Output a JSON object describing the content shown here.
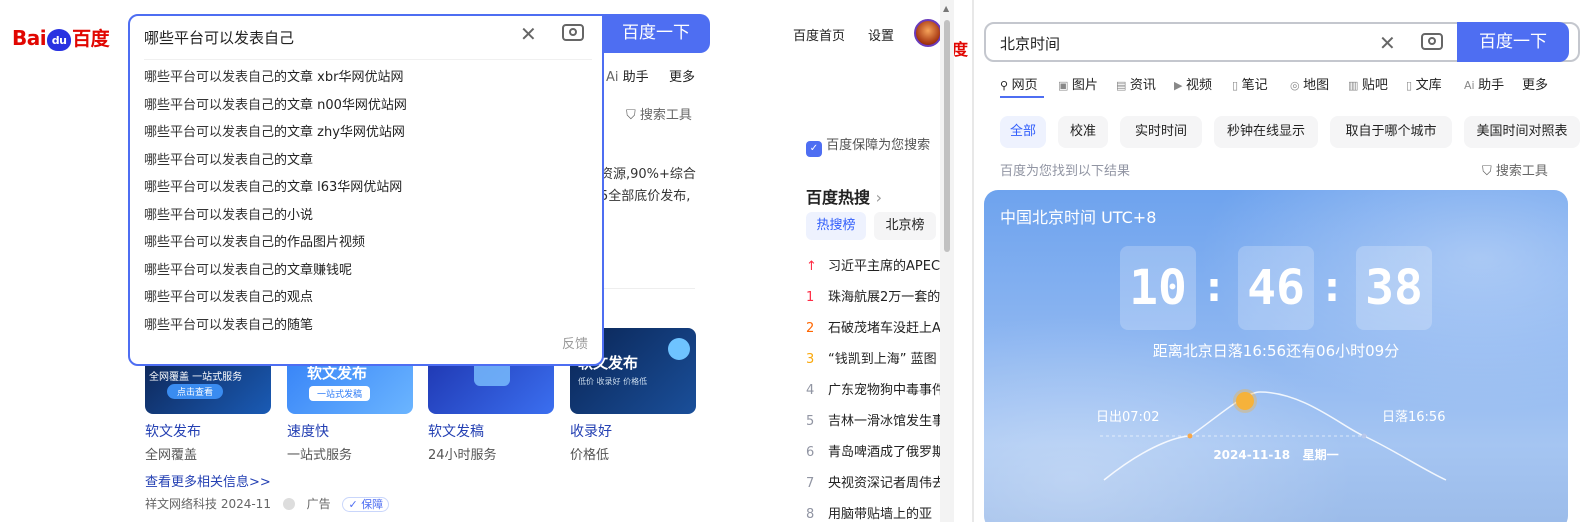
{
  "left": {
    "logo": {
      "text_a": "Bai",
      "text_paw": "du",
      "text_cn": "百度"
    },
    "search": {
      "value": "哪些平台可以发表自己",
      "button": "百度一下"
    },
    "suggestions": [
      {
        "prefix": "哪些平台可以发表自己",
        "rest": "的文章 xbr华网优站网"
      },
      {
        "prefix": "哪些平台可以发表自己",
        "rest": "的文章 n00华网优站网"
      },
      {
        "prefix": "哪些平台可以发表自己",
        "rest": "的文章 zhy华网优站网"
      },
      {
        "prefix": "哪些平台可以发表自己",
        "rest": "的文章"
      },
      {
        "prefix": "哪些平台可以发表自己",
        "rest": "的文章 l63华网优站网"
      },
      {
        "prefix": "哪些平台可以发表自己",
        "rest": "的小说"
      },
      {
        "prefix": "哪些平台可以发表自己",
        "rest": "的作品图片视频"
      },
      {
        "prefix": "哪些平台可以发表自己",
        "rest": "的文章赚钱呢"
      },
      {
        "prefix": "哪些平台可以发表自己",
        "rest": "的观点"
      },
      {
        "prefix": "哪些平台可以发表自己",
        "rest": "的随笔"
      }
    ],
    "feedback": "反馈",
    "top_links": {
      "home": "百度首页",
      "settings": "设置"
    },
    "side_tabs": {
      "assistant": "助手",
      "more": "更多",
      "search_tools": "搜索工具"
    },
    "snippet": {
      "line1": "资源,90%+综合",
      "line2": "5全部底价发布,"
    },
    "guarantee": "百度保障为您搜索",
    "ads": [
      {
        "title": "软文发布",
        "sub": "全网覆盖",
        "img_text": "全网覆盖 一站式服务",
        "img_btn": "点击查看"
      },
      {
        "title": "速度快",
        "sub": "一站式服务",
        "img_text": "软文发布",
        "img_btn": "一站式发稿"
      },
      {
        "title": "软文发稿",
        "sub": "24小时服务",
        "img_text": "",
        "img_btn": ""
      },
      {
        "title": "收录好",
        "sub": "价格低",
        "img_text": "软文发布",
        "img_btn": "低价 收录好 价格低"
      }
    ],
    "more_info": "查看更多相关信息>>",
    "source": {
      "company": "祥文网络科技 2024-11",
      "ad": "广告",
      "badge": "保障"
    },
    "hot": {
      "title": "百度热搜",
      "tabs": [
        "热搜榜",
        "北京榜"
      ],
      "rows": [
        {
          "num": "↑",
          "text": "习近平主席的APEC"
        },
        {
          "num": "1",
          "text": "珠海航展2万一套的"
        },
        {
          "num": "2",
          "text": "石破茂堵车没赶上A"
        },
        {
          "num": "3",
          "text": "“钱凯到上海” 蓝图"
        },
        {
          "num": "4",
          "text": "广东宠物狗中毒事件"
        },
        {
          "num": "5",
          "text": "吉林一滑冰馆发生事"
        },
        {
          "num": "6",
          "text": "青岛啤酒成了俄罗斯"
        },
        {
          "num": "7",
          "text": "央视资深记者周伟去"
        },
        {
          "num": "8",
          "text": "用脑带贴墙上的亚"
        }
      ]
    }
  },
  "right": {
    "search": {
      "value": "北京时间",
      "button": "百度一下"
    },
    "nav": [
      "网页",
      "图片",
      "资讯",
      "视频",
      "笔记",
      "地图",
      "贴吧",
      "文库",
      "助手",
      "更多"
    ],
    "chips": [
      "全部",
      "校准",
      "实时时间",
      "秒钟在线显示",
      "取自于哪个城市",
      "美国时间对照表"
    ],
    "result_note": "百度为您找到以下结果",
    "search_tools": "搜索工具",
    "clock": {
      "title": "中国北京时间 UTC+8",
      "hh": "10",
      "mm": "46",
      "ss": "38",
      "sunset_text": "距离北京日落16:56还有06小时09分",
      "sunrise": "日出07:02",
      "sunset": "日落16:56",
      "date": "2024-11-18",
      "weekday": "星期一"
    }
  },
  "colors": {
    "accent": "#4e6ef2",
    "brand_red": "#e10601",
    "link": "#2440b3"
  }
}
